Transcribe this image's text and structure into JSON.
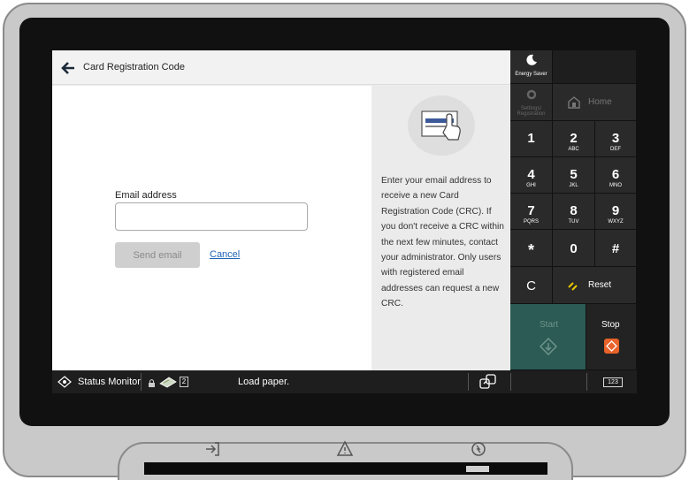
{
  "header": {
    "title": "Card Registration Code"
  },
  "form": {
    "email_label": "Email address",
    "email_value": "",
    "send_label": "Send email",
    "cancel_label": "Cancel"
  },
  "info_text": "Enter your email address to receive a new Card Registration Code (CRC). If you don't receive a CRC within the next few minutes,  contact your administrator. Only users with registered email addresses can request a new CRC.",
  "panel": {
    "energy_saver": "Energy Saver",
    "settings": "Settings/ Registration",
    "home": "Home",
    "keys": [
      {
        "num": "1",
        "sub": ""
      },
      {
        "num": "2",
        "sub": "ABC"
      },
      {
        "num": "3",
        "sub": "DEF"
      },
      {
        "num": "4",
        "sub": "GHI"
      },
      {
        "num": "5",
        "sub": "JKL"
      },
      {
        "num": "6",
        "sub": "MNO"
      },
      {
        "num": "7",
        "sub": "PQRS"
      },
      {
        "num": "8",
        "sub": "TUV"
      },
      {
        "num": "9",
        "sub": "WXYZ"
      },
      {
        "num": "*",
        "sub": ""
      },
      {
        "num": "0",
        "sub": ""
      },
      {
        "num": "#",
        "sub": ""
      }
    ],
    "clear": "C",
    "reset": "Reset",
    "start": "Start",
    "stop": "Stop"
  },
  "status_bar": {
    "status_monitor": "Status Monitor",
    "badge_count": "2",
    "message": "Load paper.",
    "keyboard_label": "123"
  },
  "colors": {
    "start": "#2b5b54",
    "stop_icon": "#e8622a",
    "reset_icon": "#e8c800",
    "link": "#1e63b5"
  }
}
